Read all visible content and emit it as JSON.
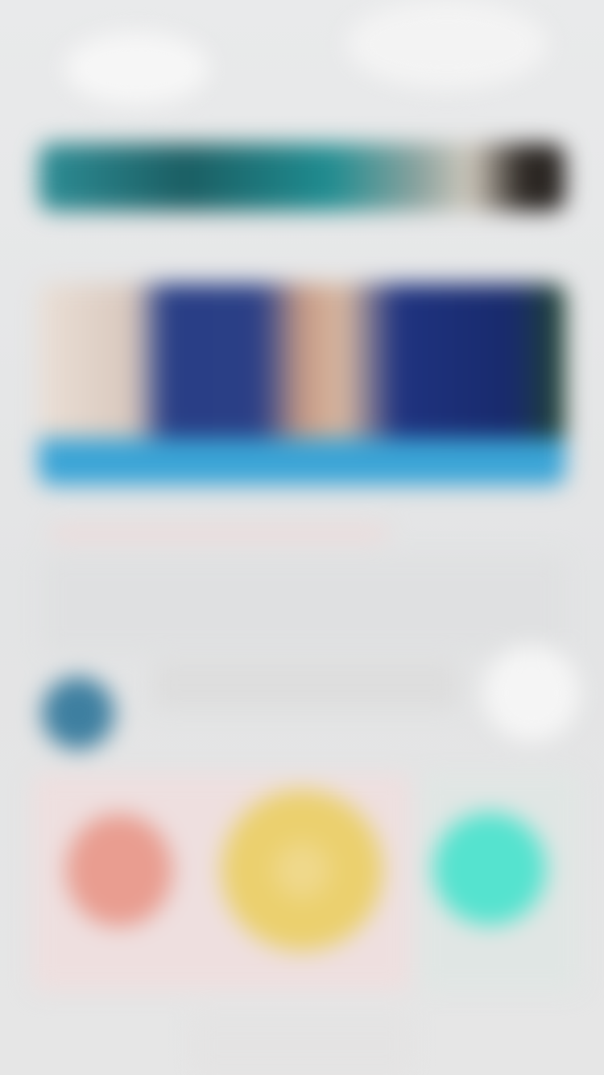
{
  "screen": {
    "title": ""
  },
  "colors": {
    "banner_teal": "#1f8c90",
    "hero_blue": "#2b3f86",
    "hero_strip": "#3aa4d6",
    "avatar_blue": "#3e7fa0",
    "action_red": "#e99d90",
    "action_yellow": "#ebd06e",
    "action_teal": "#55e3cf"
  },
  "icons": {
    "avatar": "avatar-icon",
    "action_left": "circle-red-icon",
    "action_center": "circle-yellow-icon",
    "action_right": "circle-teal-icon"
  }
}
